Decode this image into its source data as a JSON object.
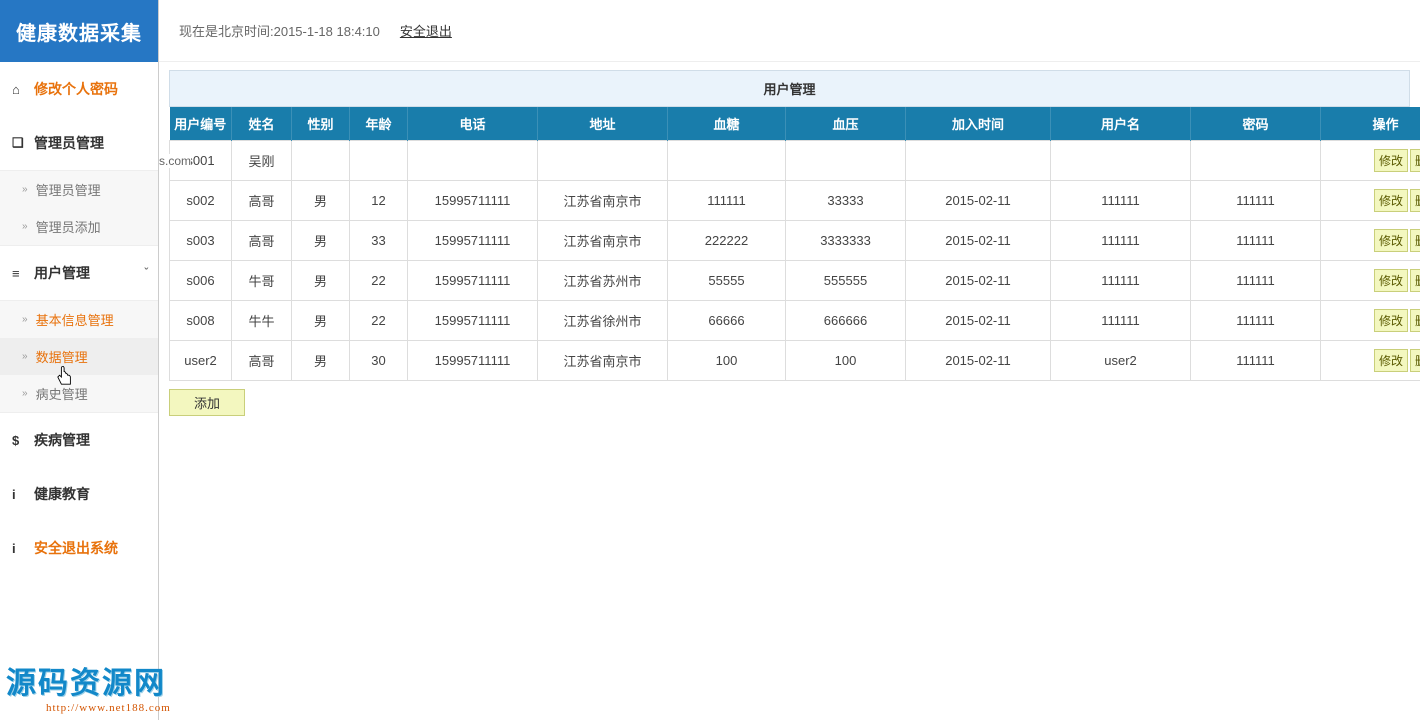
{
  "brand": "健康数据采集",
  "topbar": {
    "time_label": "现在是北京时间:2015-1-18 18:4:10",
    "logout": "安全退出"
  },
  "sidebar": {
    "modify_password": "修改个人密码",
    "admin_mgmt": {
      "label": "管理员管理",
      "items": [
        "管理员管理",
        "管理员添加"
      ]
    },
    "user_mgmt": {
      "label": "用户管理",
      "items": [
        "基本信息管理",
        "数据管理",
        "病史管理"
      ]
    },
    "disease_mgmt": "疾病管理",
    "health_edu": "健康教育",
    "safe_exit": "安全退出系统"
  },
  "icon_glyphs": {
    "home": "⌂",
    "square": "❏",
    "list": "≡",
    "dollar": "$",
    "info": "i",
    "arrow": "»",
    "chevron": "ˇ"
  },
  "panel_title": "用户管理",
  "stray_text": "s.com",
  "table": {
    "headers": [
      "用户编号",
      "姓名",
      "性别",
      "年龄",
      "电话",
      "地址",
      "血糖",
      "血压",
      "加入时间",
      "用户名",
      "密码",
      "操作"
    ],
    "rows": [
      {
        "id": "s001",
        "name": "吴刚",
        "gender": "",
        "age": "",
        "phone": "",
        "addr": "",
        "sugar": "",
        "pressure": "",
        "join": "",
        "user": "",
        "pass": ""
      },
      {
        "id": "s002",
        "name": "高哥",
        "gender": "男",
        "age": "12",
        "phone": "15995711111",
        "addr": "江苏省南京市",
        "sugar": "111111",
        "pressure": "33333",
        "join": "2015-02-11",
        "user": "111111",
        "pass": "111111"
      },
      {
        "id": "s003",
        "name": "高哥",
        "gender": "男",
        "age": "33",
        "phone": "15995711111",
        "addr": "江苏省南京市",
        "sugar": "222222",
        "pressure": "3333333",
        "join": "2015-02-11",
        "user": "111111",
        "pass": "111111"
      },
      {
        "id": "s006",
        "name": "牛哥",
        "gender": "男",
        "age": "22",
        "phone": "15995711111",
        "addr": "江苏省苏州市",
        "sugar": "55555",
        "pressure": "555555",
        "join": "2015-02-11",
        "user": "111111",
        "pass": "111111"
      },
      {
        "id": "s008",
        "name": "牛牛",
        "gender": "男",
        "age": "22",
        "phone": "15995711111",
        "addr": "江苏省徐州市",
        "sugar": "66666",
        "pressure": "666666",
        "join": "2015-02-11",
        "user": "111111",
        "pass": "111111"
      },
      {
        "id": "user2",
        "name": "高哥",
        "gender": "男",
        "age": "30",
        "phone": "15995711111",
        "addr": "江苏省南京市",
        "sugar": "100",
        "pressure": "100",
        "join": "2015-02-11",
        "user": "user2",
        "pass": "111111"
      }
    ],
    "op_edit": "修改",
    "op_delete": "删除"
  },
  "add_button": "添加",
  "watermark": {
    "line1": "源码资源网",
    "line2": "http://www.net188.com"
  }
}
